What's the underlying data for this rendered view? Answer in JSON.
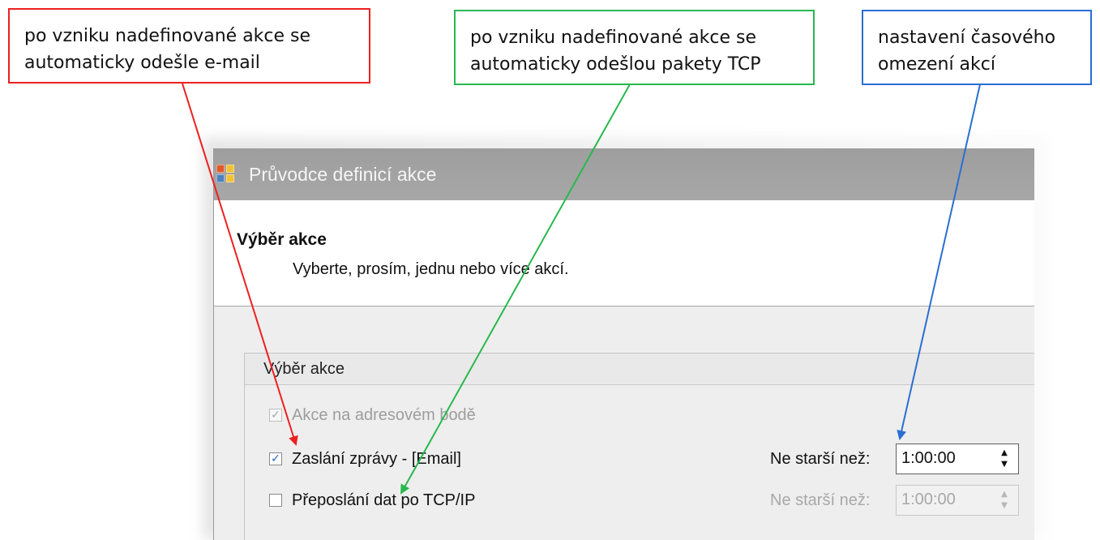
{
  "callouts": {
    "email": {
      "line1": "po vzniku nadefinované akce se",
      "line2": "automaticky odešle e-mail",
      "color": "#ee2020"
    },
    "tcp": {
      "line1": "po vzniku nadefinované akce se",
      "line2": "automaticky odešlou pakety TCP",
      "color": "#29b84f"
    },
    "timeout": {
      "line1": "nastavení časového",
      "line2": "omezení akcí",
      "color": "#2a6fd2"
    }
  },
  "dialog": {
    "title": "Průvodce definicí akce",
    "app_icon": "app-grid-icon",
    "header": {
      "title": "Výběr akce",
      "subtitle": "Vyberte, prosím, jednu nebo více akcí."
    },
    "group": {
      "title": "Výběr akce",
      "items": [
        {
          "label": "Akce na adresovém bodě",
          "checked": true,
          "enabled": false
        },
        {
          "label": "Zaslání zprávy - [Email]",
          "checked": true,
          "enabled": true,
          "time_label": "Ne starší než:",
          "time_value": "1:00:00",
          "time_enabled": true
        },
        {
          "label": "Přeposlání dat po TCP/IP",
          "checked": false,
          "enabled": true,
          "time_label": "Ne starší než:",
          "time_value": "1:00:00",
          "time_enabled": false
        }
      ]
    }
  },
  "icons": {
    "checkbox_checked": "✓",
    "spin_up": "▲",
    "spin_down": "▼"
  },
  "colors": {
    "titlebar": "#a3a3a3",
    "dialog_bg": "#eeeeee",
    "checkbox_check": "#1f63b8"
  }
}
